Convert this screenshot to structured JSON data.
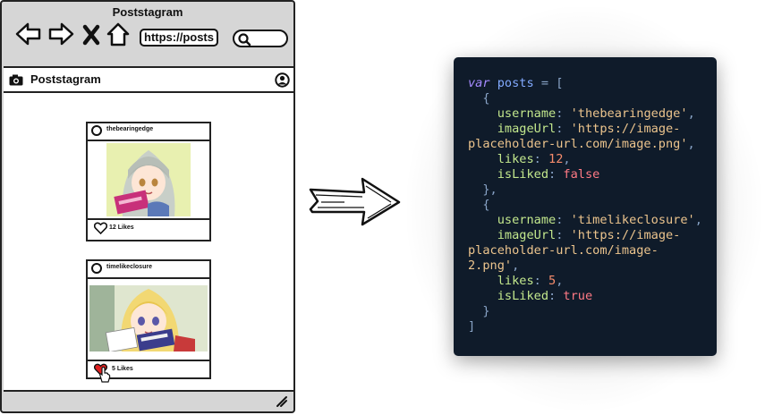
{
  "browser": {
    "title": "Poststagram",
    "url": "https://posts",
    "app_title": "Poststagram"
  },
  "posts": [
    {
      "username": "thebearingedge",
      "likes_text": "12 Likes",
      "liked": false
    },
    {
      "username": "timelikeclosure",
      "likes_text": "5 Likes",
      "liked": true
    }
  ],
  "code": {
    "keyword": "var",
    "identifier": "posts",
    "open_bracket": "[",
    "close_bracket": "]",
    "items": [
      {
        "username_key": "username",
        "username_value": "'thebearingedge'",
        "image_key": "imageUrl",
        "image_value_line1": "'https://image-",
        "image_value_line2": "placeholder-url.com/image.png'",
        "likes_key": "likes",
        "likes_value": "12",
        "liked_key": "isLiked",
        "liked_value": "false"
      },
      {
        "username_key": "username",
        "username_value": "'timelikeclosure'",
        "image_key": "imageUrl",
        "image_value_line1": "'https://image-",
        "image_value_line2": "placeholder-url.com/image-",
        "image_value_line3": "2.png'",
        "likes_key": "likes",
        "likes_value": "5",
        "liked_key": "isLiked",
        "liked_value": "true"
      }
    ]
  },
  "colors": {
    "code_background": "#0f1b2a",
    "liked_heart": "#e02020"
  }
}
